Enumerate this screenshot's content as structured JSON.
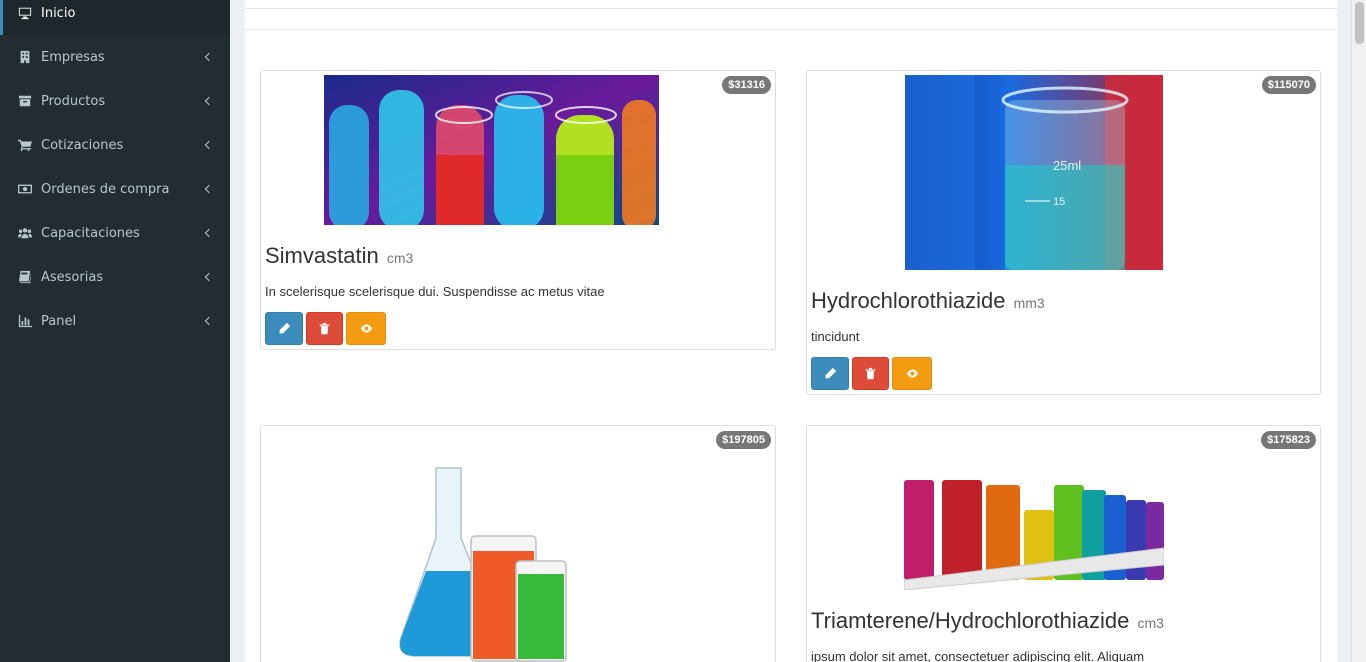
{
  "sidebar": {
    "items": [
      {
        "label": "Inicio",
        "icon": "desktop-icon",
        "active": true
      },
      {
        "label": "Empresas",
        "icon": "building-icon"
      },
      {
        "label": "Productos",
        "icon": "archive-icon"
      },
      {
        "label": "Cotizaciones",
        "icon": "cart-icon"
      },
      {
        "label": "Ordenes de compra",
        "icon": "money-icon"
      },
      {
        "label": "Capacitaciones",
        "icon": "users-icon"
      },
      {
        "label": "Asesorias",
        "icon": "book-icon"
      },
      {
        "label": "Panel",
        "icon": "bar-chart-icon"
      }
    ]
  },
  "products": [
    {
      "name": "Simvastatin",
      "unit": "cm3",
      "price": "$31316",
      "description": "In scelerisque scelerisque dui. Suspendisse ac metus vitae",
      "image": "colorful-test-tubes"
    },
    {
      "name": "Hydrochlorothiazide",
      "unit": "mm3",
      "price": "$115070",
      "description": "tincidunt",
      "image": "beaker-25ml"
    },
    {
      "name": "",
      "unit": "",
      "price": "$197805",
      "description": "",
      "image": "flask-and-beakers"
    },
    {
      "name": "Triamterene/Hydrochlorothiazide",
      "unit": "cm3",
      "price": "$175823",
      "description": "ipsum dolor sit amet, consectetuer adipiscing elit. Aliquam",
      "image": "test-tube-rack"
    }
  ],
  "colors": {
    "sidebar_bg": "#222d32",
    "accent": "#3c8dbc",
    "danger": "#dd4b39",
    "warning": "#f39c12",
    "badge": "#777777"
  }
}
